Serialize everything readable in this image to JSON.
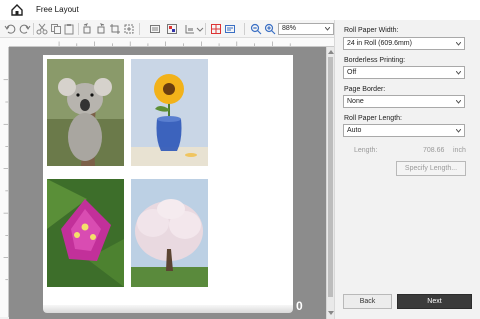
{
  "window": {
    "title": "Free Layout"
  },
  "toolbar": {
    "zoom_value": "88%"
  },
  "settings": {
    "roll_width": {
      "label": "Roll Paper Width:",
      "value": "24 in Roll (609.6mm)"
    },
    "borderless": {
      "label": "Borderless Printing:",
      "value": "Off"
    },
    "page_border": {
      "label": "Page Border:",
      "value": "None"
    },
    "roll_length": {
      "label": "Roll Paper Length:",
      "value": "Auto"
    },
    "length": {
      "label": "Length:",
      "value": "708.66",
      "unit": "inch"
    },
    "specify_length_button": "Specify Length..."
  },
  "footer": {
    "back_label": "Back",
    "next_label": "Next"
  },
  "canvas": {
    "roll_end_marker": "0"
  },
  "colors": {
    "canvas_bg": "#8c8c8c",
    "primary_button": "#3b3b3b"
  }
}
